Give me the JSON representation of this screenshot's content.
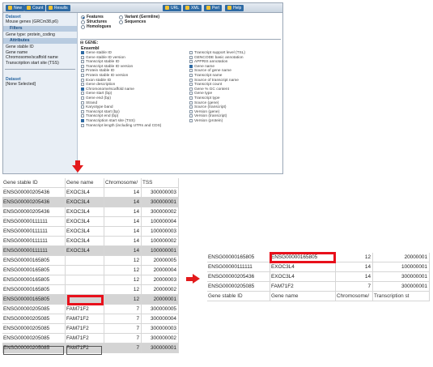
{
  "toolbar": {
    "new_label": "New",
    "count_label": "Count",
    "results_label": "Results",
    "url_label": "URL",
    "xml_label": "XML",
    "perl_label": "Perl",
    "help_label": "Help"
  },
  "sidebar": {
    "dataset_heading": "Dataset",
    "dataset_name": "Mouse genes (GRCm38.p6)",
    "filters_heading": "Filters",
    "filter_value": "Gene type: protein_coding",
    "attributes_heading": "Attributes",
    "attributes": [
      "Gene stable ID",
      "Gene name",
      "Chromosome/scaffold name",
      "Transcription start site (TSS)"
    ],
    "dataset2_heading": "Dataset",
    "dataset2_value": "[None Selected]"
  },
  "main": {
    "radios": [
      {
        "label": "Features",
        "selected": true
      },
      {
        "label": "Variant (Germline)",
        "selected": false
      },
      {
        "label": "Structures",
        "selected": false
      },
      {
        "label": "Sequences",
        "selected": false
      },
      {
        "label": "Homologues",
        "selected": false
      }
    ],
    "gene_section": "⊟ GENE:",
    "ensembl_heading": "Ensembl",
    "attributes_left": [
      {
        "label": "Gene stable ID",
        "checked": true
      },
      {
        "label": "Gene stable ID version",
        "checked": false
      },
      {
        "label": "Transcript stable ID",
        "checked": false
      },
      {
        "label": "Transcript stable ID version",
        "checked": false
      },
      {
        "label": "Protein stable ID",
        "checked": false
      },
      {
        "label": "Protein stable ID version",
        "checked": false
      },
      {
        "label": "Exon stable ID",
        "checked": false
      },
      {
        "label": "Gene description",
        "checked": false
      },
      {
        "label": "Chromosome/scaffold name",
        "checked": true
      },
      {
        "label": "Gene start (bp)",
        "checked": false
      },
      {
        "label": "Gene end (bp)",
        "checked": false
      },
      {
        "label": "Strand",
        "checked": false
      },
      {
        "label": "Karyotype band",
        "checked": false
      },
      {
        "label": "Transcript start (bp)",
        "checked": false
      },
      {
        "label": "Transcript end (bp)",
        "checked": false
      },
      {
        "label": "Transcription start site (TSS)",
        "checked": true
      },
      {
        "label": "Transcript length (including UTRs and CDS)",
        "checked": false
      }
    ],
    "attributes_right": [
      {
        "label": "Transcript support level (TSL)",
        "checked": false
      },
      {
        "label": "GENCODE basic annotation",
        "checked": false
      },
      {
        "label": "APPRIS annotation",
        "checked": false
      },
      {
        "label": "Gene name",
        "checked": true
      },
      {
        "label": "Source of gene name",
        "checked": false
      },
      {
        "label": "Transcript name",
        "checked": false
      },
      {
        "label": "Source of transcript name",
        "checked": false
      },
      {
        "label": "Transcript count",
        "checked": false
      },
      {
        "label": "Gene % GC content",
        "checked": false
      },
      {
        "label": "Gene type",
        "checked": false
      },
      {
        "label": "Transcript type",
        "checked": false
      },
      {
        "label": "Source (gene)",
        "checked": false
      },
      {
        "label": "Source (transcript)",
        "checked": false
      },
      {
        "label": "Version (gene)",
        "checked": false
      },
      {
        "label": "Version (transcript)",
        "checked": false
      },
      {
        "label": "Version (protein)",
        "checked": false
      }
    ]
  },
  "table1": {
    "headers": [
      "Gene stable ID",
      "Gene name",
      "Chromosome/",
      "TSS"
    ],
    "rows": [
      {
        "id": "ENSG00000205436",
        "name": "EXOC3L4",
        "chr": "14",
        "tss": "300000003",
        "gray": false
      },
      {
        "id": "ENSG00000205436",
        "name": "EXOC3L4",
        "chr": "14",
        "tss": "300000001",
        "gray": true
      },
      {
        "id": "ENSG00000205436",
        "name": "EXOC3L4",
        "chr": "14",
        "tss": "300000002",
        "gray": false
      },
      {
        "id": "ENSG00000111111",
        "name": "EXOC3L4",
        "chr": "14",
        "tss": "100000004",
        "gray": false
      },
      {
        "id": "ENSG00000111111",
        "name": "EXOC3L4",
        "chr": "14",
        "tss": "100000003",
        "gray": false
      },
      {
        "id": "ENSG00000111111",
        "name": "EXOC3L4",
        "chr": "14",
        "tss": "100000002",
        "gray": false
      },
      {
        "id": "ENSG00000111111",
        "name": "EXOC3L4",
        "chr": "14",
        "tss": "100000001",
        "gray": true
      },
      {
        "id": "ENSG00000165805",
        "name": "",
        "chr": "12",
        "tss": "20000005",
        "gray": false
      },
      {
        "id": "ENSG00000165805",
        "name": "",
        "chr": "12",
        "tss": "20000004",
        "gray": false
      },
      {
        "id": "ENSG00000165805",
        "name": "",
        "chr": "12",
        "tss": "20000003",
        "gray": false
      },
      {
        "id": "ENSG00000165805",
        "name": "",
        "chr": "12",
        "tss": "20000002",
        "gray": false
      },
      {
        "id": "ENSG00000165805",
        "name": "",
        "chr": "12",
        "tss": "20000001",
        "gray": true
      },
      {
        "id": "ENSG00000205085",
        "name": "FAM71F2",
        "chr": "7",
        "tss": "300000005",
        "gray": false
      },
      {
        "id": "ENSG00000205085",
        "name": "FAM71F2",
        "chr": "7",
        "tss": "300000004",
        "gray": false
      },
      {
        "id": "ENSG00000205085",
        "name": "FAM71F2",
        "chr": "7",
        "tss": "300000003",
        "gray": false
      },
      {
        "id": "ENSG00000205085",
        "name": "FAM71F2",
        "chr": "7",
        "tss": "300000002",
        "gray": false
      },
      {
        "id": "ENSG00000205085",
        "name": "FAM71F2",
        "chr": "7",
        "tss": "300000001",
        "gray": true
      }
    ]
  },
  "table2": {
    "headers": [
      "Gene stable ID",
      "Gene name",
      "Chromosome/",
      "Transcription st"
    ],
    "rows": [
      {
        "id": "ENSG00000165805",
        "name": "ENSG00000165805",
        "chr": "12",
        "tss": "20000001"
      },
      {
        "id": "ENSG00000111111",
        "name": "EXOC3L4",
        "chr": "14",
        "tss": "100000001"
      },
      {
        "id": "ENSG00000205436",
        "name": "EXOC3L4",
        "chr": "14",
        "tss": "300000001"
      },
      {
        "id": "ENSG00000205085",
        "name": "FAM71F2",
        "chr": "7",
        "tss": "300000001"
      }
    ]
  },
  "colors": {
    "highlight": "#e8101b",
    "arrow": "#e31a1c",
    "toolbar_button": "#2e6aa3",
    "gray_row": "#d4d4d4"
  }
}
